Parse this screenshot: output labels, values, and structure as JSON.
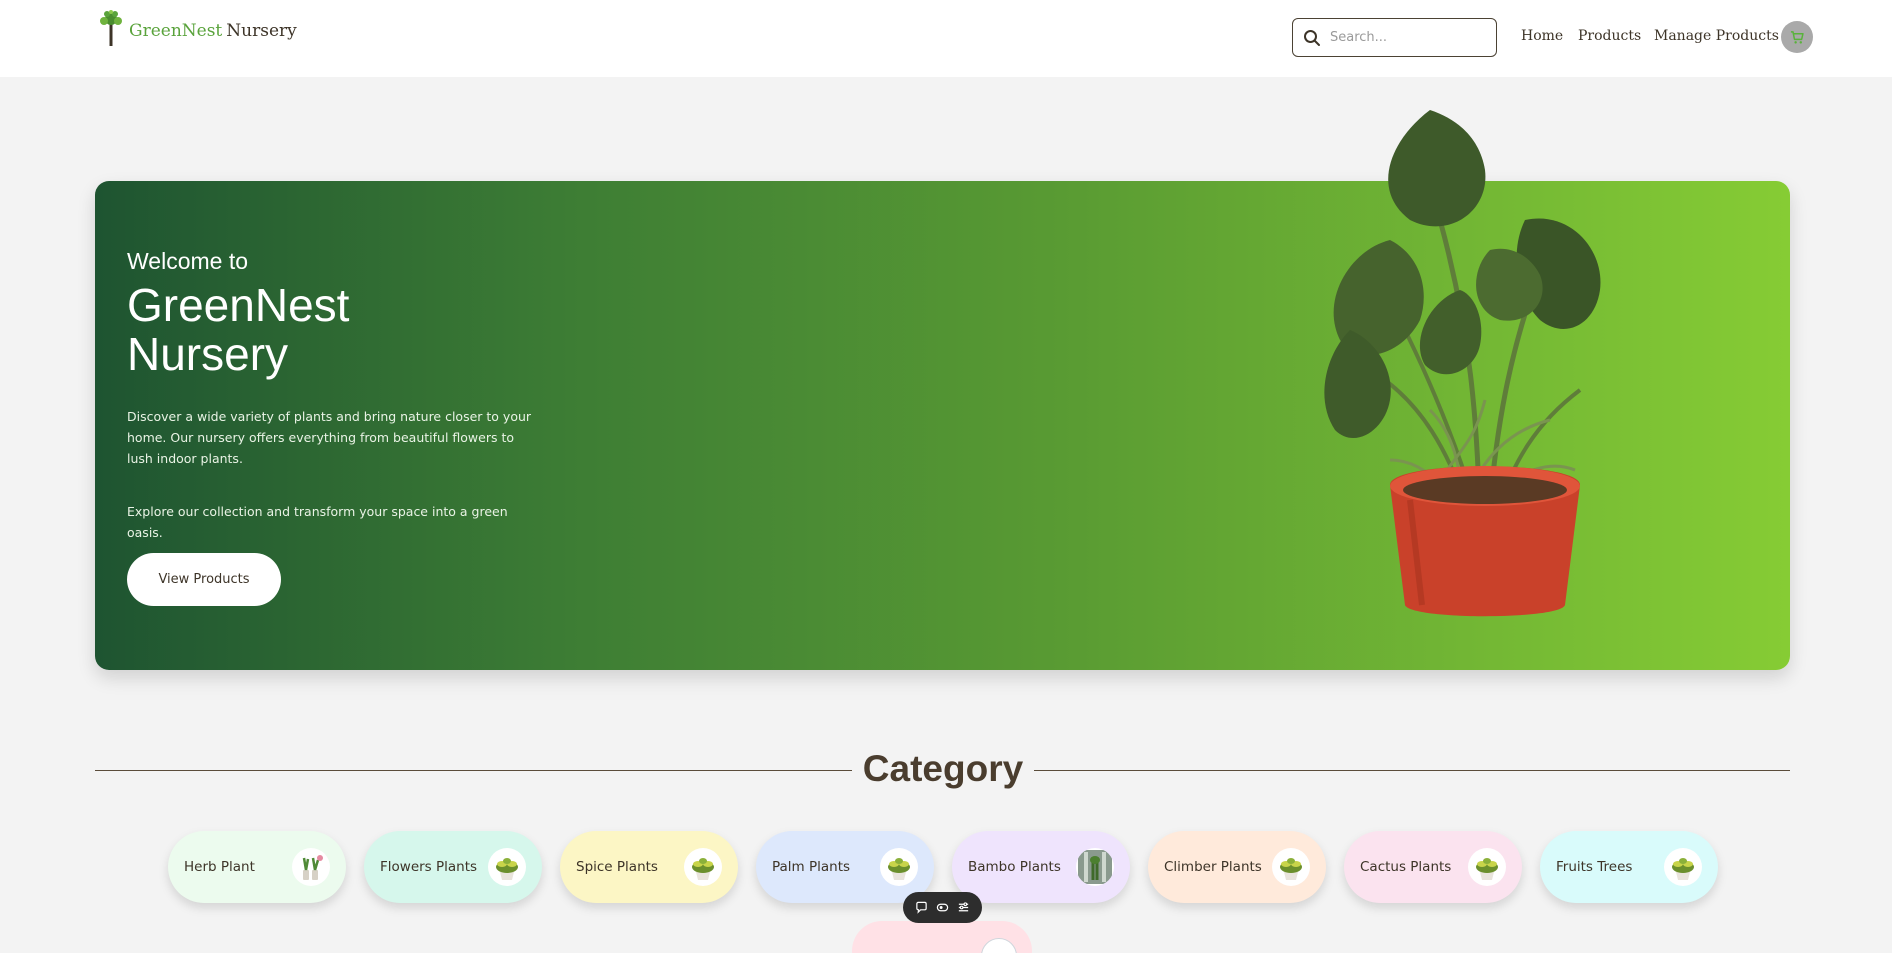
{
  "header": {
    "logo": {
      "brand_green": "GreenNest",
      "brand_dark": "Nursery",
      "icon": "tree-icon"
    },
    "search": {
      "placeholder": "Search...",
      "value": "",
      "icon": "search-icon"
    },
    "nav": {
      "home": "Home",
      "products": "Products",
      "manage": "Manage Products"
    },
    "cart": {
      "icon": "cart-icon"
    }
  },
  "hero": {
    "welcome": "Welcome to",
    "title": "GreenNest Nursery",
    "description": "Discover a wide variety of plants and bring nature closer to your home. Our nursery offers everything from beautiful flowers to lush indoor plants.",
    "description2": "Explore our collection and transform your space into a green oasis.",
    "button": "View Products"
  },
  "category": {
    "title": "Category",
    "items": [
      {
        "label": "Herb Plant",
        "color": "#ecfbee",
        "thumb": "herb"
      },
      {
        "label": "Flowers Plants",
        "color": "#d6f7ec",
        "thumb": "plant"
      },
      {
        "label": "Spice Plants",
        "color": "#fcf6c5",
        "thumb": "plant"
      },
      {
        "label": "Palm Plants",
        "color": "#dde8fc",
        "thumb": "plant"
      },
      {
        "label": "Bambo Plants",
        "color": "#efe4fd",
        "thumb": "bamboo"
      },
      {
        "label": "Climber Plants",
        "color": "#ffeadb",
        "thumb": "plant"
      },
      {
        "label": "Cactus Plants",
        "color": "#fbe3ef",
        "thumb": "plant"
      },
      {
        "label": "Fruits Trees",
        "color": "#d9fbfb",
        "thumb": "plant"
      }
    ]
  },
  "colors": {
    "hero_start": "#1e5431",
    "hero_end": "#86cc34",
    "text_dark": "#3d3428",
    "brand_green": "#5aa33c"
  },
  "toolbar": {
    "icons": [
      "comment-icon",
      "eye-icon",
      "sliders-icon"
    ]
  }
}
